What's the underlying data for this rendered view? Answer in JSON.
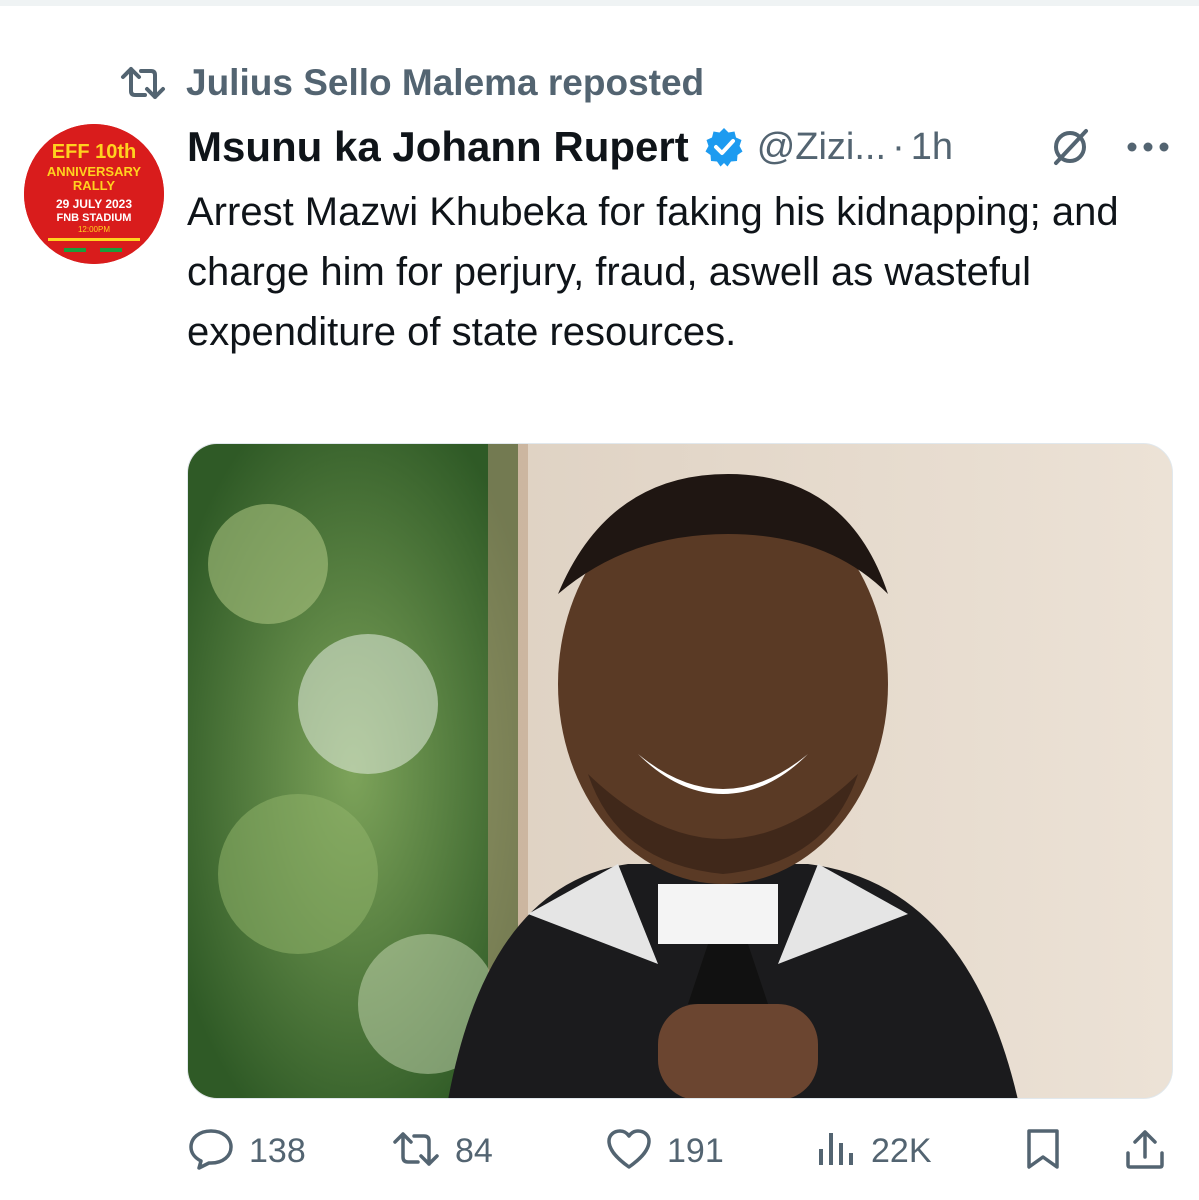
{
  "repost": {
    "icon": "repost-icon",
    "text": "Julius Sello Malema reposted"
  },
  "tweet": {
    "avatar": {
      "icon": "avatar",
      "lines": [
        "EFF 10th",
        "ANNIVERSARY",
        "RALLY",
        "29 JULY 2023",
        "FNB STADIUM",
        "12:00PM"
      ]
    },
    "display_name": "Msunu ka Johann Rupert",
    "handle": "@Zizi...",
    "separator": "·",
    "time": "1h",
    "text": "Arrest Mazwi Khubeka for faking his kidnapping; and charge him for perjury, fraud, aswell as wasteful expenditure of state resources.",
    "verified_color": "#1d9bf0"
  },
  "actions": {
    "reply": {
      "icon": "reply-icon",
      "count": "138"
    },
    "repost": {
      "icon": "repost-icon",
      "count": "84"
    },
    "like": {
      "icon": "heart-icon",
      "count": "191"
    },
    "views": {
      "icon": "views-icon",
      "count": "22K"
    },
    "bookmark": {
      "icon": "bookmark-icon"
    },
    "share": {
      "icon": "share-icon"
    }
  },
  "colors": {
    "text": "#0f1419",
    "secondary": "#536471",
    "verified": "#1d9bf0",
    "avatar_bg": "#d91c1c"
  }
}
